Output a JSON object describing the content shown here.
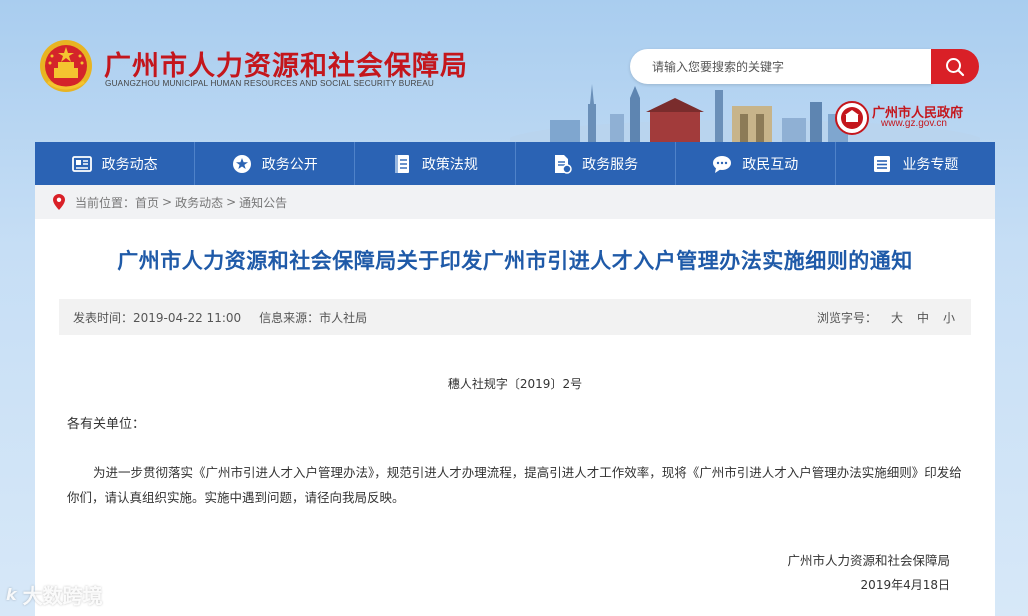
{
  "header": {
    "title": "广州市人力资源和社会保障局",
    "subtitle": "GUANGZHOU MUNICIPAL HUMAN RESOURCES AND SOCIAL SECURITY BUREAU",
    "search": {
      "placeholder": "请输入您要搜索的关键字"
    },
    "gov_link": {
      "name": "广州市人民政府",
      "url": "www.gz.gov.cn"
    }
  },
  "nav": {
    "items": [
      {
        "label": "政务动态",
        "icon": "news-icon"
      },
      {
        "label": "政务公开",
        "icon": "star-icon"
      },
      {
        "label": "政策法规",
        "icon": "book-icon"
      },
      {
        "label": "政务服务",
        "icon": "document-icon"
      },
      {
        "label": "政民互动",
        "icon": "chat-icon"
      },
      {
        "label": "业务专题",
        "icon": "list-icon"
      }
    ]
  },
  "breadcrumb": {
    "prefix": "当前位置：",
    "items": [
      "首页",
      "政务动态",
      "通知公告"
    ],
    "separator": ">"
  },
  "article": {
    "title": "广州市人力资源和社会保障局关于印发广州市引进人才入户管理办法实施细则的通知",
    "published": "发表时间：2019-04-22 11:00",
    "source": "信息来源：市人社局",
    "font_size_label": "浏览字号：",
    "font_sizes": [
      "大",
      "中",
      "小"
    ],
    "doc_number": "穗人社规字〔2019〕2号",
    "salutation": "各有关单位：",
    "body": "为进一步贯彻落实《广州市引进人才入户管理办法》，规范引进人才办理流程，提高引进人才工作效率，现将《广州市引进人才入户管理办法实施细则》印发给你们，请认真组织实施。实施中遇到问题，请径向我局反映。",
    "signature": "广州市人力资源和社会保障局",
    "date": "2019年4月18日"
  },
  "watermark": {
    "text": "大数跨境",
    "logo": "k"
  },
  "colors": {
    "brand_red": "#c4161c",
    "nav_blue": "#2b63b4",
    "title_blue": "#1f5aa8"
  }
}
